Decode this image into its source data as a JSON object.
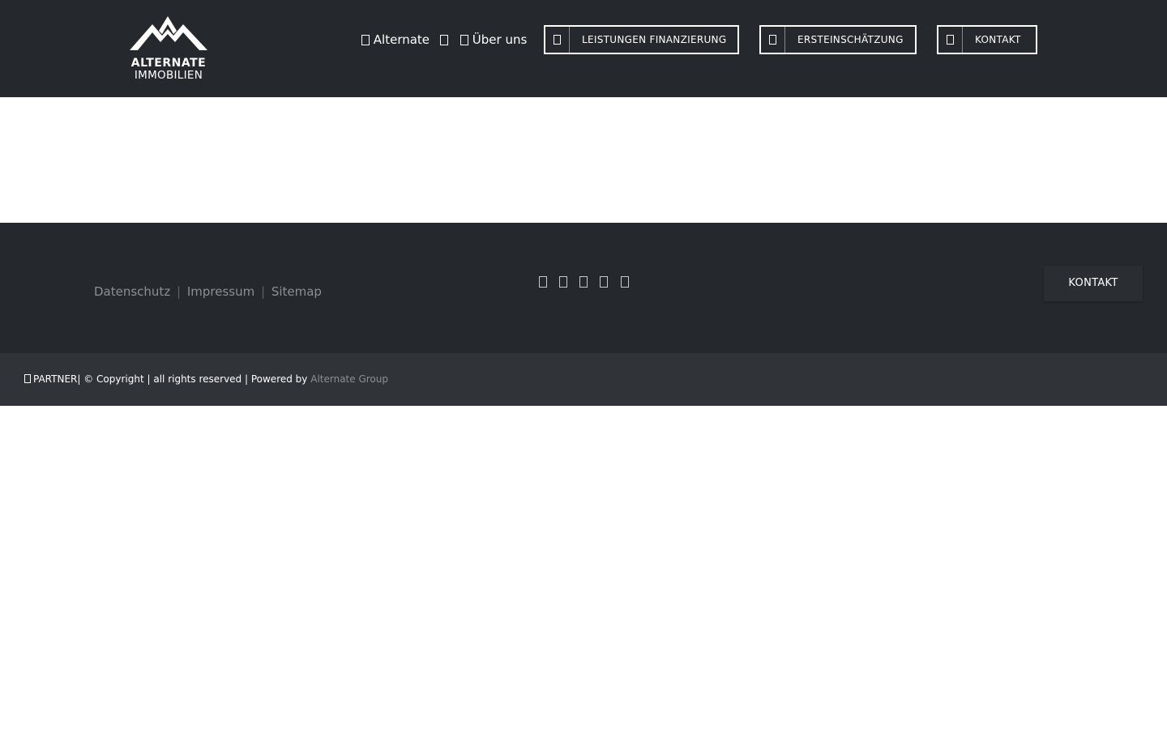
{
  "header": {
    "logo": {
      "line1": "ALTERNATE",
      "line2": "IMMOBILIEN"
    },
    "nav": [
      {
        "label": "Alternate",
        "icon": "menu-icon",
        "dropdown_icon": "chevron-down-icon"
      },
      {
        "label": "Über uns",
        "icon": "info-icon"
      }
    ],
    "buttons": [
      {
        "label": "LEISTUNGEN FINANZIERUNG",
        "icon": "finance-icon"
      },
      {
        "label": "ERSTEINSCHÄTZUNG",
        "icon": "calculator-icon"
      },
      {
        "label": "KONTAKT",
        "icon": "envelope-icon"
      }
    ]
  },
  "footer": {
    "links": [
      "Datenschutz",
      "Impressum",
      "Sitemap"
    ],
    "separator": "|",
    "social_icons": [
      "facebook-icon",
      "twitter-icon",
      "instagram-icon",
      "linkedin-icon",
      "xing-icon"
    ],
    "contact_button": "KONTAKT"
  },
  "bottom_bar": {
    "partner": "PARTNER",
    "copyright_text": "| © Copyright | all rights reserved | Powered by",
    "powered_link": "Alternate Group"
  },
  "colors": {
    "header_bg": "#25282d",
    "footer_bg": "#25282d",
    "bottom_bar_bg": "#303338",
    "link_gray": "#8c8f94",
    "text_white": "#ffffff"
  }
}
